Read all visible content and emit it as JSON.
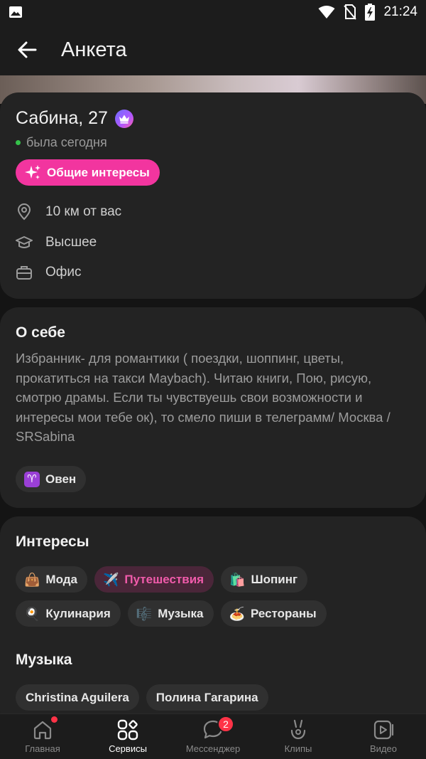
{
  "status_bar": {
    "time": "21:24",
    "icons": [
      "image-icon",
      "wifi-icon",
      "no-sim-icon",
      "battery-charging-icon"
    ]
  },
  "app_bar": {
    "title": "Анкета",
    "back_icon": "arrow-left-icon"
  },
  "profile": {
    "name": "Сабина, 27",
    "premium_icon": "crown-icon",
    "last_seen": "была сегодня",
    "common_interests_label": "Общие интересы",
    "info": [
      {
        "icon": "location-pin-icon",
        "text": "10 км от вас"
      },
      {
        "icon": "graduation-cap-icon",
        "text": "Высшее"
      },
      {
        "icon": "briefcase-icon",
        "text": "Офис"
      }
    ]
  },
  "about": {
    "title": "О себе",
    "text": "Избранник- для романтики ( поездки, шоппинг, цветы, прокатиться на такси Maybach). Читаю книги, Пою, рисую, смотрю драмы. Если ты чувствуешь свои возможности и интересы мои тебе ок), то смело пиши в телеграмм/ Москва / SRSabina",
    "zodiac": {
      "emoji": "♈",
      "label": "Овен"
    }
  },
  "interests": {
    "title": "Интересы",
    "items": [
      {
        "emoji": "👜",
        "label": "Мода",
        "active": false
      },
      {
        "emoji": "✈️",
        "label": "Путешествия",
        "active": true
      },
      {
        "emoji": "🛍️",
        "label": "Шопинг",
        "active": false
      },
      {
        "emoji": "🍳",
        "label": "Кулинария",
        "active": false
      },
      {
        "emoji": "🎼",
        "label": "Музыка",
        "active": false
      },
      {
        "emoji": "🍝",
        "label": "Рестораны",
        "active": false
      }
    ]
  },
  "music": {
    "title": "Музыка",
    "items": [
      "Christina Aguilera",
      "Полина Гагарина"
    ]
  },
  "bottom_nav": {
    "items": [
      {
        "label": "Главная",
        "icon": "home-icon",
        "dot": true
      },
      {
        "label": "Сервисы",
        "icon": "services-grid-icon",
        "active": true
      },
      {
        "label": "Мессенджер",
        "icon": "chat-bubble-icon",
        "badge": "2"
      },
      {
        "label": "Клипы",
        "icon": "clips-icon"
      },
      {
        "label": "Видео",
        "icon": "video-play-icon"
      }
    ]
  },
  "colors": {
    "background": "#141414",
    "card": "#232323",
    "accent_pink": "#f2359f",
    "online_green": "#35c24a",
    "badge_red": "#ff3347"
  }
}
